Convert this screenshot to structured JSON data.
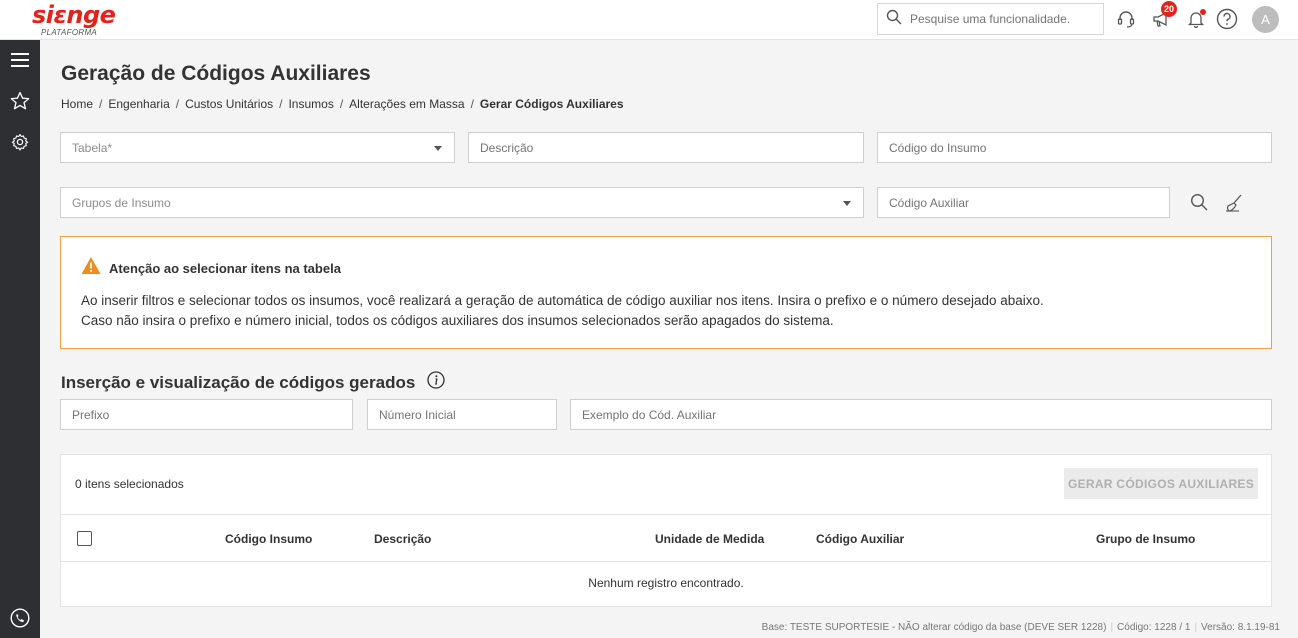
{
  "header": {
    "logo_main": "siɛnge",
    "logo_sub": "PLATAFORMA",
    "search_placeholder": "Pesquise uma funcionalidade.",
    "notifications_count": "20",
    "avatar_initial": "A"
  },
  "page": {
    "title": "Geração de Códigos Auxiliares",
    "breadcrumb": [
      "Home",
      "Engenharia",
      "Custos Unitários",
      "Insumos",
      "Alterações em Massa",
      "Gerar Códigos Auxiliares"
    ]
  },
  "filters": {
    "tabela": "Tabela*",
    "descricao": "Descrição",
    "codigo_insumo": "Código do Insumo",
    "grupos_insumo": "Grupos de Insumo",
    "codigo_auxiliar": "Código Auxiliar"
  },
  "alert": {
    "title": "Atenção ao selecionar itens na tabela",
    "line1": "Ao inserir filtros e selecionar todos os insumos, você realizará a geração de automática de código auxiliar nos itens. Insira o prefixo e o número desejado abaixo.",
    "line2": "Caso não insira o prefixo e número inicial, todos os códigos auxiliares dos insumos selecionados serão apagados do sistema."
  },
  "insertion": {
    "title": "Inserção e visualização de códigos gerados",
    "prefixo": "Prefixo",
    "numero_inicial": "Número Inicial",
    "exemplo": "Exemplo do Cód. Auxiliar"
  },
  "table": {
    "selected_text": "0 itens selecionados",
    "generate_button": "GERAR CÓDIGOS AUXILIARES",
    "columns": [
      "Código Insumo",
      "Descrição",
      "Unidade de Medida",
      "Código Auxiliar",
      "Grupo de Insumo"
    ],
    "empty_text": "Nenhum registro encontrado."
  },
  "footer": {
    "base": "Base: TESTE SUPORTESIE - NÃO alterar código da base (DEVE SER 1228)",
    "codigo": "Código: 1228 / 1",
    "versao": "Versão: 8.1.19-81"
  },
  "colors": {
    "brand": "#e2231a",
    "alert_border": "#f0a048",
    "warning_icon": "#f08c1e",
    "rail": "#2d2f33"
  }
}
